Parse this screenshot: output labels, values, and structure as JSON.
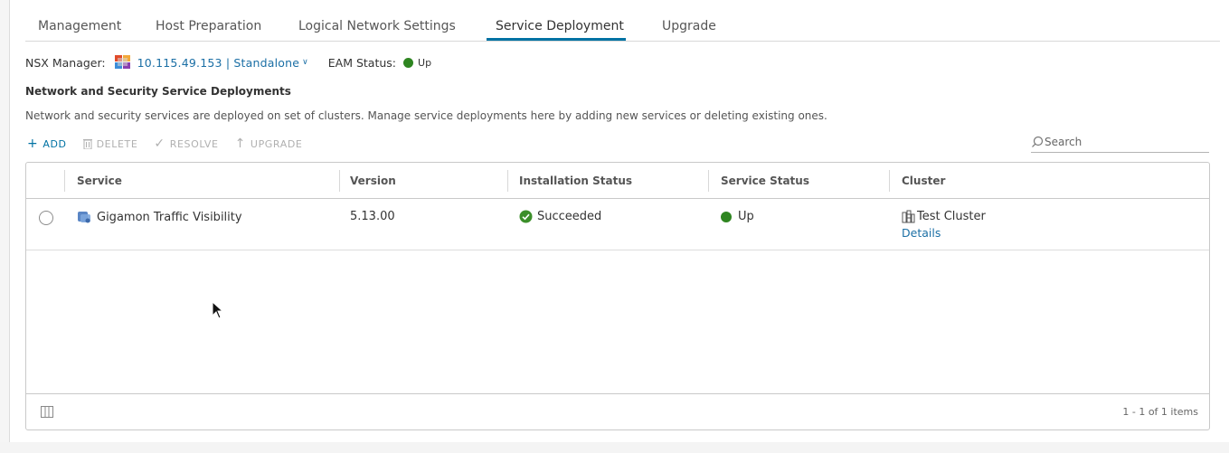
{
  "tabs": [
    {
      "label": "Management",
      "active": false
    },
    {
      "label": "Host Preparation",
      "active": false
    },
    {
      "label": "Logical Network Settings",
      "active": false
    },
    {
      "label": "Service Deployment",
      "active": true
    },
    {
      "label": "Upgrade",
      "active": false
    }
  ],
  "manager": {
    "label": "NSX Manager:",
    "value": "10.115.49.153 | Standalone",
    "eam_label": "EAM Status:",
    "eam_value": "Up"
  },
  "section": {
    "title": "Network and Security Service Deployments",
    "description": "Network and security services are deployed on set of clusters. Manage service deployments here by adding new services or deleting existing ones."
  },
  "toolbar": {
    "add": "ADD",
    "delete": "DELETE",
    "resolve": "RESOLVE",
    "upgrade": "UPGRADE"
  },
  "search": {
    "placeholder": "Search"
  },
  "grid": {
    "columns": [
      "Service",
      "Version",
      "Installation Status",
      "Service Status",
      "Cluster"
    ],
    "rows": [
      {
        "service": "Gigamon Traffic Visibility",
        "version": "5.13.00",
        "installation_status": "Succeeded",
        "service_status": "Up",
        "cluster": "Test Cluster",
        "details": "Details"
      }
    ],
    "footer": "1 - 1 of 1 items"
  },
  "colors": {
    "accent": "#0072a3",
    "link": "#1b6fa5",
    "status_green": "#2e8520",
    "disabled": "#b0b0b0"
  },
  "icons": {
    "manager": "nsx-manager-icon",
    "status": "status-dot-icon",
    "add": "plus-icon",
    "delete": "trash-icon",
    "resolve": "check-icon",
    "upgrade": "arrow-up-icon",
    "search": "search-icon",
    "service": "service-icon",
    "success": "success-check-icon",
    "cluster": "cluster-icon",
    "column_toggle": "column-toggle-icon"
  }
}
